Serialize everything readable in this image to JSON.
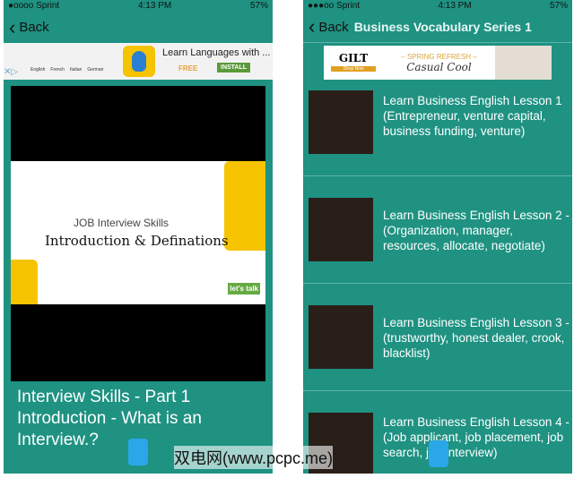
{
  "left": {
    "status": {
      "carrier": "●oooo Sprint",
      "time": "4:13 PM",
      "battery": "57%"
    },
    "nav": {
      "back": "Back"
    },
    "ad": {
      "title": "Learn Languages with ...",
      "free": "FREE",
      "install": "INSTALL",
      "langs": [
        "English",
        "French",
        "Italian",
        "German"
      ]
    },
    "video": {
      "line1": "JOB Interview Skills",
      "line2": "Introduction & Definations",
      "brand": "let's talk"
    },
    "title": "Interview Skills -  Part 1 Introduction - What is an Interview.?"
  },
  "right": {
    "status": {
      "carrier": "●●●oo Sprint",
      "time": "4:13 PM",
      "battery": "57%"
    },
    "nav": {
      "back": "Back",
      "title": "Business Vocabulary Series 1"
    },
    "ad": {
      "brand": "GILT",
      "shop": "Shop Now",
      "tag": "– SPRING REFRESH –",
      "headline": "Casual Cool"
    },
    "items": [
      {
        "label": "Learn Business English Lesson 1 (Entrepreneur, venture capital, business funding, venture)"
      },
      {
        "label": "Learn Business English Lesson 2 - (Organization, manager, resources, allocate, negotiate)"
      },
      {
        "label": "Learn Business English Lesson 3 - (trustworthy, honest dealer, crook, blacklist)"
      },
      {
        "label": "Learn Business English Lesson 4 - (Job applicant, job placement, job search, job interview)"
      }
    ]
  },
  "watermark": "双电网(www.pcpc.me)"
}
